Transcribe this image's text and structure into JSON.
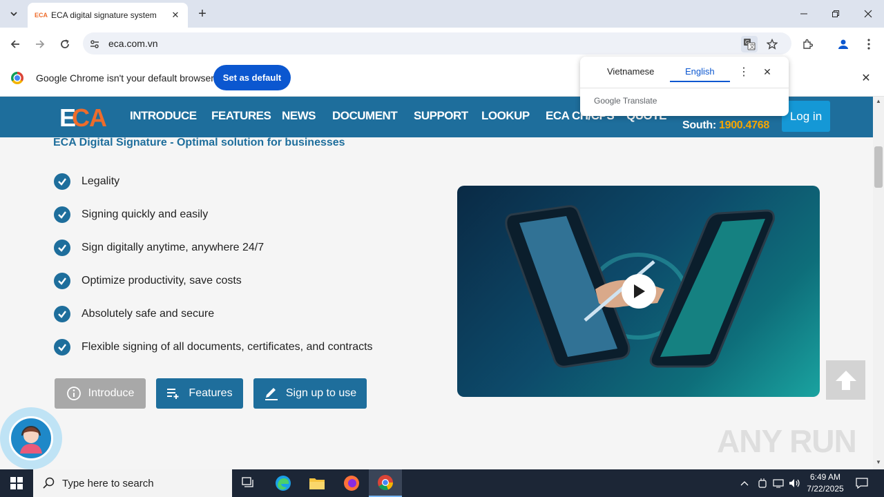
{
  "browser": {
    "tab_title": "ECA digital signature system",
    "tab_favicon_text": "ECA",
    "url": "eca.com.vn"
  },
  "infobar": {
    "message": "Google Chrome isn't your default browser",
    "set_default_label": "Set as default"
  },
  "translate_popup": {
    "source_lang": "Vietnamese",
    "target_lang": "English",
    "brand": "Google Translate"
  },
  "site": {
    "logo_e": "E",
    "logo_ca": "CA",
    "nav": [
      "INTRODUCE",
      "FEATURES",
      "NEWS",
      "DOCUMENT",
      "SUPPORT",
      "LOOKUP",
      "ECA CH/CPS",
      "QUOTE"
    ],
    "hotline_label": "South: ",
    "hotline_number": "1900.4768",
    "login_label": "Log in",
    "accent_color": "#1e6e9c",
    "brand_orange": "#ee6c2b"
  },
  "main": {
    "subtitle": "ECA Digital Signature - Optimal solution for businesses",
    "features": [
      "Legality",
      "Signing quickly and easily",
      "Sign digitally anytime, anywhere 24/7",
      "Optimize productivity, save costs",
      "Absolutely safe and secure",
      "Flexible signing of all documents, certificates, and contracts"
    ],
    "buttons": {
      "introduce": "Introduce",
      "features": "Features",
      "signup": "Sign up to use"
    }
  },
  "watermark": "ANY RUN",
  "taskbar": {
    "search_placeholder": "Type here to search",
    "time": "6:49 AM",
    "date": "7/22/2025"
  }
}
